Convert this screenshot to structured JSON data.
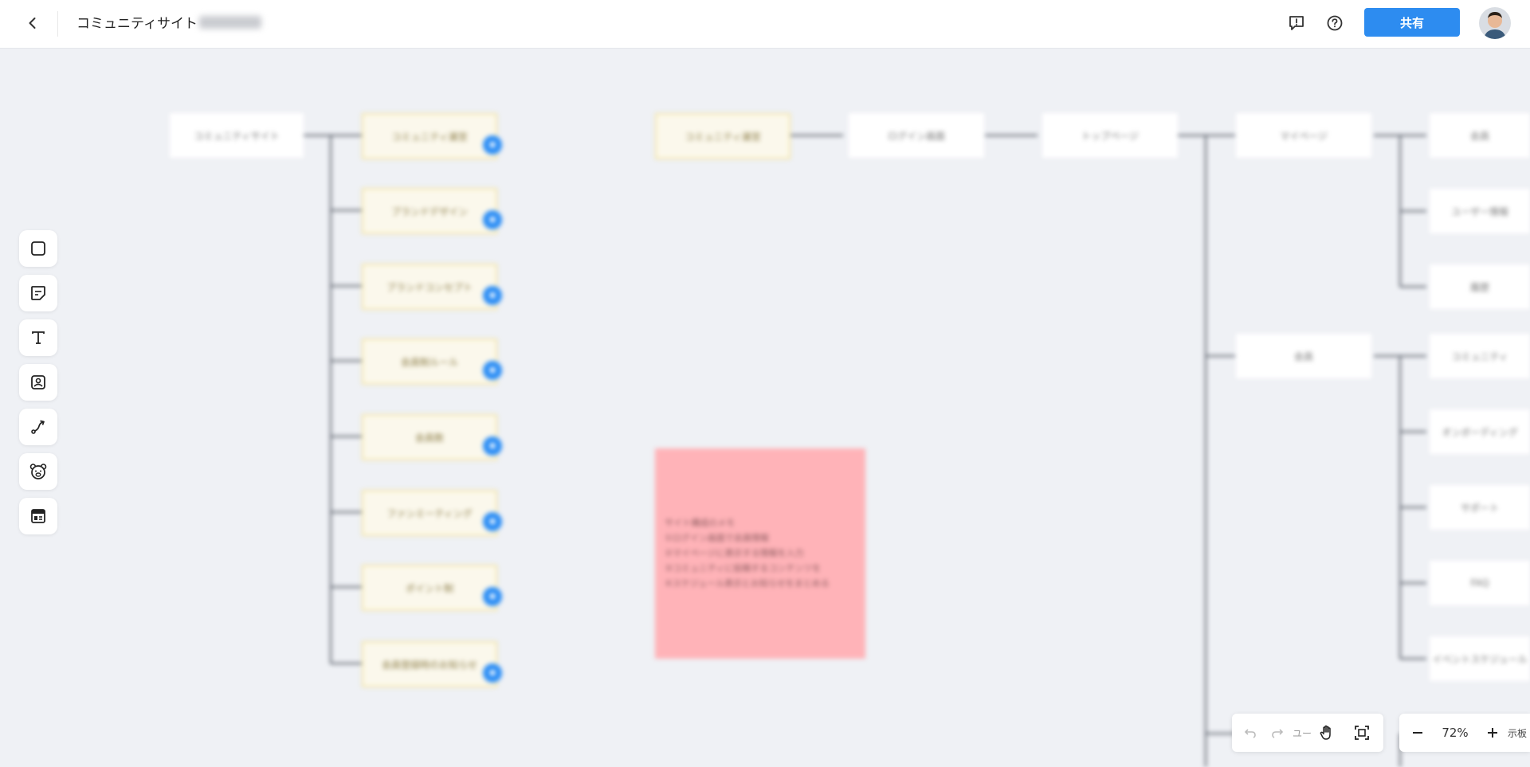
{
  "header": {
    "title": "コミュニティサイト",
    "share_label": "共有",
    "icons": [
      "chevron-left-icon",
      "feedback-icon",
      "help-icon"
    ]
  },
  "toolbar": {
    "tools": [
      "rectangle-tool",
      "sticky-note-tool",
      "text-tool",
      "image-tool",
      "connector-tool",
      "sticker-tool",
      "template-tool"
    ]
  },
  "canvas": {
    "root_node": "コミュニティサイト",
    "left_children": [
      "コミュニティ運営",
      "ブランドデザイン",
      "ブランドコンセプト",
      "会員制ルール",
      "会員数",
      "ファンミーティング",
      "ポイント制",
      "会員登録時のお知らせ"
    ],
    "badge_text": "●",
    "flow_nodes": [
      "コミュニティ運営",
      "ログイン画面",
      "トップページ",
      "マイページ",
      "会員"
    ],
    "branch_nodes": [
      "マイページ",
      "会員",
      "ユーザー情報",
      "履歴"
    ],
    "sub_nodes": [
      "コミュニティ",
      "オンボーディング",
      "サポート",
      "FAQ",
      "イベントスケジュール"
    ],
    "sticky_lines": [
      "サイト構成のメモ",
      "①ログイン画面で会員情報",
      "②マイページに表示する情報を入力",
      "③コミュニティに投稿するコンテンツを",
      "④スケジュール表示とお知らせをまとめる"
    ]
  },
  "bottom": {
    "undo_icon": "undo-icon",
    "redo_icon": "redo-icon",
    "partial_text": "ユー",
    "zoom": "72%",
    "right_text": "示板"
  },
  "colors": {
    "accent": "#2d8cf0",
    "sticky": "#ffb3b8",
    "canvas_bg": "#eff1f5",
    "yellow_node": "#fbf8ec"
  }
}
